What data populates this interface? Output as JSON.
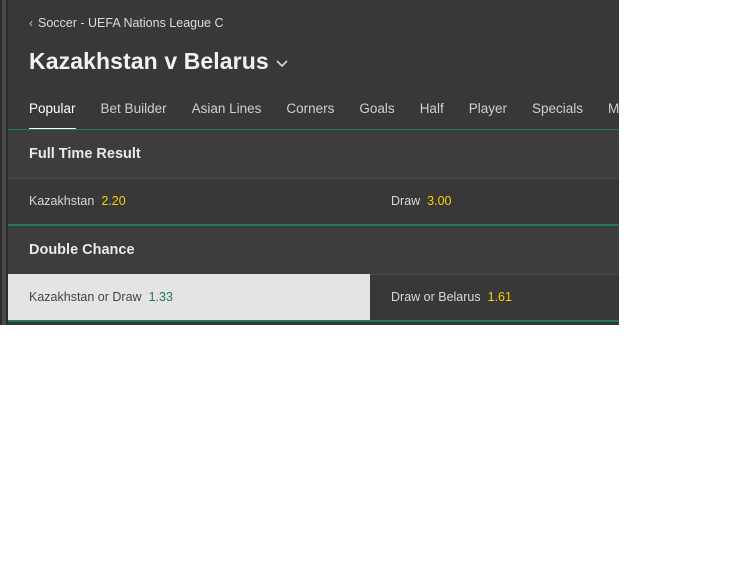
{
  "breadcrumb": {
    "chevron": "‹",
    "label": "Soccer - UEFA Nations League C"
  },
  "event": {
    "title": "Kazakhstan v Belarus"
  },
  "tabs": [
    {
      "label": "Popular",
      "active": true
    },
    {
      "label": "Bet Builder"
    },
    {
      "label": "Asian Lines"
    },
    {
      "label": "Corners"
    },
    {
      "label": "Goals"
    },
    {
      "label": "Half"
    },
    {
      "label": "Player"
    },
    {
      "label": "Specials"
    },
    {
      "label": "Minutes"
    }
  ],
  "markets": [
    {
      "title": "Full Time Result",
      "selections": [
        {
          "name": "Kazakhstan",
          "odds": "2.20"
        },
        {
          "name": "Draw",
          "odds": "3.00"
        }
      ]
    },
    {
      "title": "Double Chance",
      "selections": [
        {
          "name": "Kazakhstan or Draw",
          "odds": "1.33",
          "highlighted": true
        },
        {
          "name": "Draw or Belarus",
          "odds": "1.61"
        }
      ]
    }
  ],
  "colors": {
    "background": "#383838",
    "accent_green": "#1f7a52",
    "odds_yellow": "#f5d100",
    "highlight_bg": "#e4e4e4"
  }
}
